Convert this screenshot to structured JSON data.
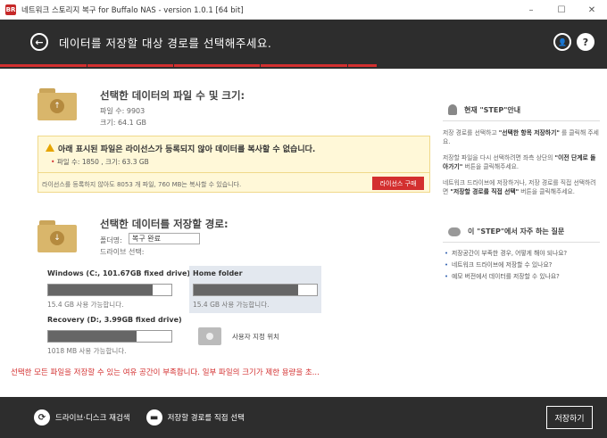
{
  "window": {
    "title": "네트워크 스토리지 복구 for Buffalo NAS - version 1.0.1 [64 bit]",
    "app_icon_text": "BR",
    "minimize": "–",
    "maximize": "☐",
    "close": "✕"
  },
  "header": {
    "back_icon": "←",
    "title": "데이터를 저장할 대상 경로를 선택해주세요.",
    "user_icon": "👤",
    "help_icon": "?"
  },
  "progress": {
    "steps": 7,
    "completed_fraction": 0.62
  },
  "source": {
    "title": "선택한 데이터의 파일 수 및 크기:",
    "file_count": "파일 수: 9903",
    "size": "크기: 64.1 GB",
    "badge": "↑"
  },
  "warning": {
    "text": "아래 표시된 파일은 라이선스가 등록되지 않아 데이터를 복사할 수 없습니다.",
    "detail": "파일 수: 1850 , 크기: 63.3 GB",
    "foot": "라이선스를 등록하지 않아도 8053 개 파일, 760 MB는 복사할 수 있습니다.",
    "license_button": "라이선스 구매"
  },
  "destination": {
    "title": "선택한 데이터를 저장할 경로:",
    "folder_label": "폴더명:",
    "folder_value": "복구 완료",
    "drive_label": "드라이브 선택:",
    "badge": "↓"
  },
  "drives": [
    {
      "name": "Windows (C:, 101.67GB fixed drive)",
      "free": "15.4 GB 사용 가능합니다.",
      "used_fraction": 0.85
    },
    {
      "name": "Home folder",
      "free": "15.4 GB 사용 가능합니다.",
      "used_fraction": 0.85
    },
    {
      "name": "Recovery (D:, 3.99GB fixed drive)",
      "free": "1018 MB 사용 가능합니다.",
      "used_fraction": 0.72
    }
  ],
  "custom_location": "사용자 지정 위치",
  "error": "선택한 모든 파일을 저장할 수 있는 여유 공간이 부족합니다. 일부 파일의 크기가 제한 용량을 초...",
  "side": {
    "step_title": "현재 \"STEP\"안내",
    "p1a": "저장 경로를 선택하고 ",
    "p1b": "\"선택한 항목 저장하기\"",
    "p1c": " 를 클릭해 주세요.",
    "p2a": "저장할 파일을 다시 선택하려면 좌측 상단의 ",
    "p2b": "\"이전 단계로 돌아가기\"",
    "p2c": " 버튼을 클릭해주세요.",
    "p3a": "네트워크 드라이브에 저장하거나, 저장 경로를 직접 선택하려면 ",
    "p3b": "\"저장할 경로를 직접 선택\"",
    "p3c": " 버튼을 클릭해주세요.",
    "faq_title": "이 \"STEP\"에서 자주 하는 질문",
    "faq": [
      "저장공간이 부족한 경우, 어떻게 해야 되나요?",
      "네트워크 드라이브에 저장할 수 있나요?",
      "예모 버전에서 데이터를 저장할 수 있나요?"
    ]
  },
  "footer": {
    "rescan_icon": "⟳",
    "rescan_label": "드라이브·디스크 재검색",
    "direct_icon": "▬",
    "direct_label": "저장할 경로를 직접 선택",
    "save_label": "저장하기"
  },
  "colors": {
    "accent": "#d32f2f",
    "dark": "#2d2d2d",
    "folder": "#d9b66b",
    "warning_bg": "#fff8d8"
  }
}
